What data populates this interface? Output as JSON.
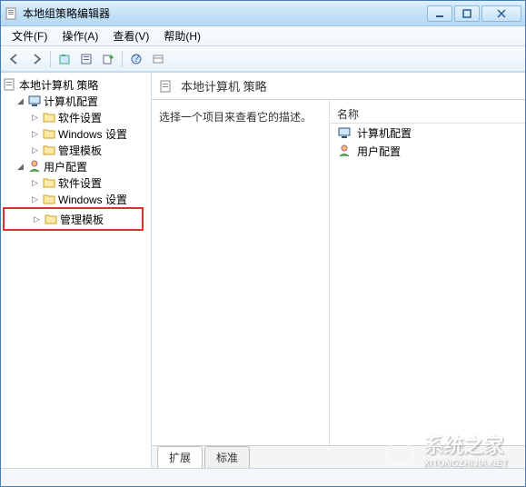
{
  "window": {
    "title": "本地组策略编辑器"
  },
  "menus": {
    "file": "文件(F)",
    "action": "操作(A)",
    "view": "查看(V)",
    "help": "帮助(H)"
  },
  "tree": {
    "root": "本地计算机 策略",
    "computer_config": "计算机配置",
    "cc_software": "软件设置",
    "cc_windows": "Windows 设置",
    "cc_admin": "管理模板",
    "user_config": "用户配置",
    "uc_software": "软件设置",
    "uc_windows": "Windows 设置",
    "uc_admin": "管理模板"
  },
  "details": {
    "header_title": "本地计算机 策略",
    "description": "选择一个项目来查看它的描述。",
    "name_header": "名称",
    "item_computer": "计算机配置",
    "item_user": "用户配置"
  },
  "tabs": {
    "extended": "扩展",
    "standard": "标准"
  },
  "watermark": {
    "text": "系统之家",
    "url": "XITONGZHIJIA.NET"
  }
}
